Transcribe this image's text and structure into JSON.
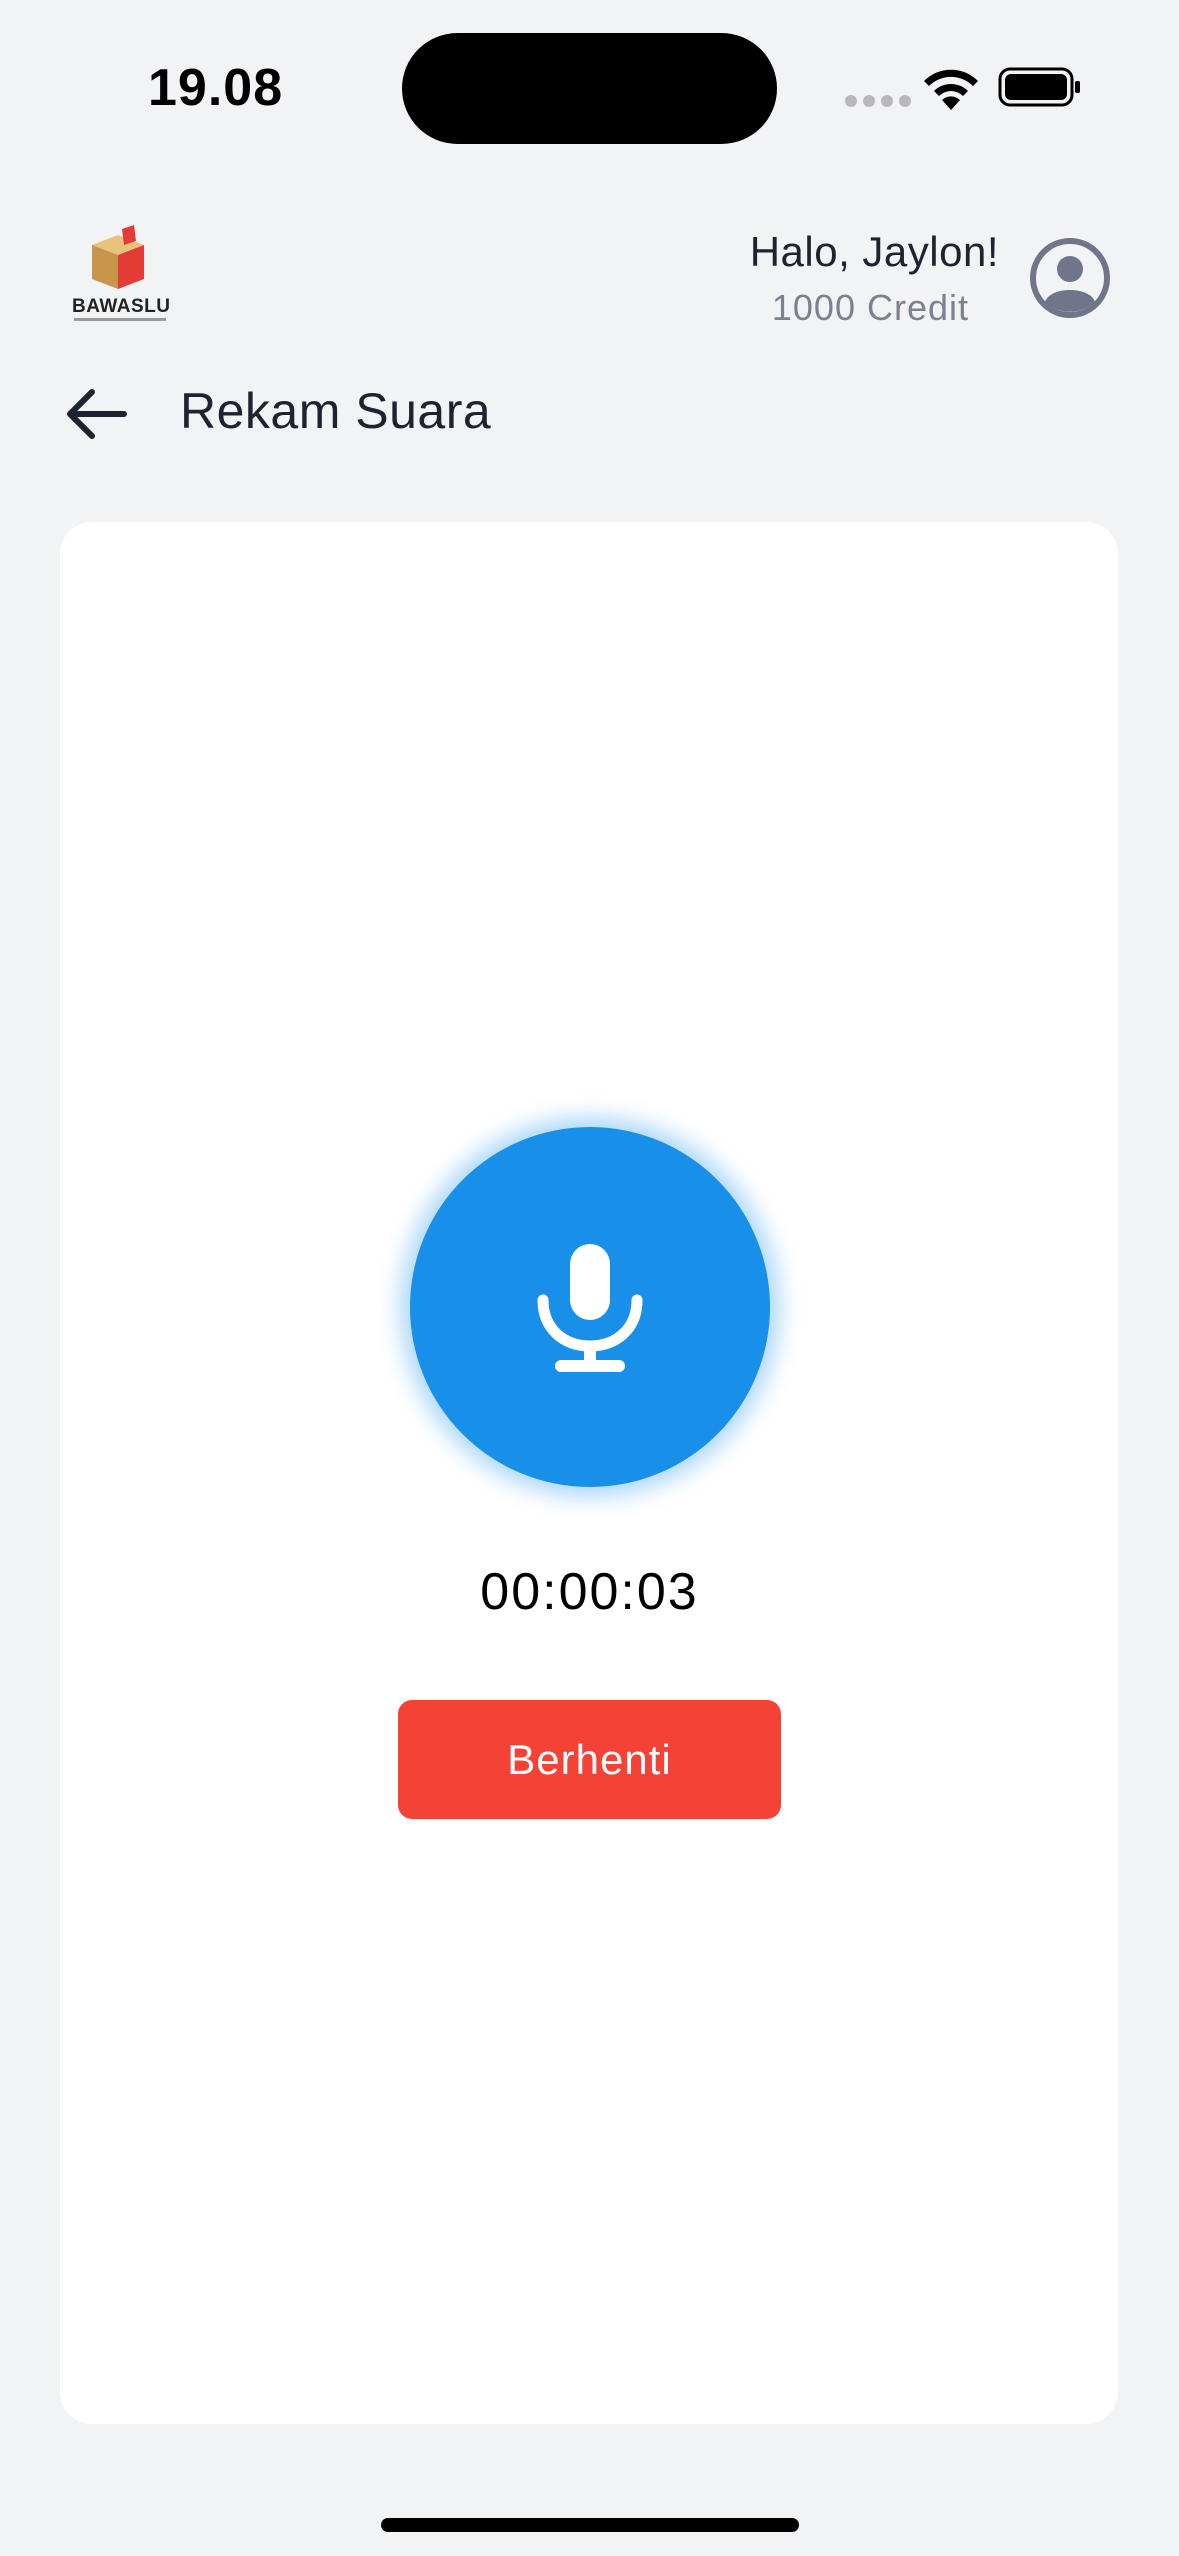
{
  "status_bar": {
    "time": "19.08"
  },
  "header": {
    "logo_text": "BAWASLU",
    "greeting": "Halo, Jaylon!",
    "credit": "1000 Credit"
  },
  "title_bar": {
    "title": "Rekam Suara"
  },
  "recorder": {
    "timer": "00:00:03",
    "stop_label": "Berhenti"
  },
  "colors": {
    "background": "#f2f3f5",
    "card": "#ffffff",
    "mic_blue": "#1890ea",
    "stop_red": "#f44336",
    "text_primary": "#1f2230",
    "text_secondary": "#7c8190"
  },
  "icons": {
    "back": "arrow-left-icon",
    "avatar": "user-circle-icon",
    "mic": "microphone-icon",
    "wifi": "wifi-icon",
    "battery": "battery-icon"
  }
}
